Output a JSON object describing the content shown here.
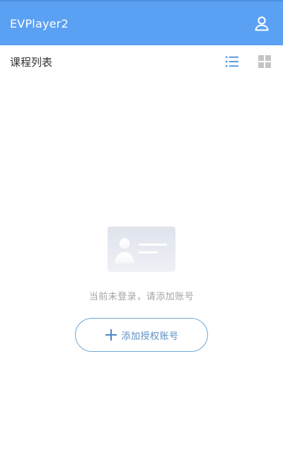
{
  "app": {
    "title": "EVPlayer2",
    "header_color": "#5ba1f3"
  },
  "header": {
    "account_icon": "person-icon"
  },
  "toolbar": {
    "title": "课程列表",
    "list_view_icon": "list-icon",
    "grid_view_icon": "grid-icon",
    "active_view": "list"
  },
  "empty_state": {
    "illustration_icon": "id-card-icon",
    "message": "当前未登录，请添加账号",
    "add_button_label": "添加授权账号",
    "add_button_icon": "plus-icon"
  }
}
